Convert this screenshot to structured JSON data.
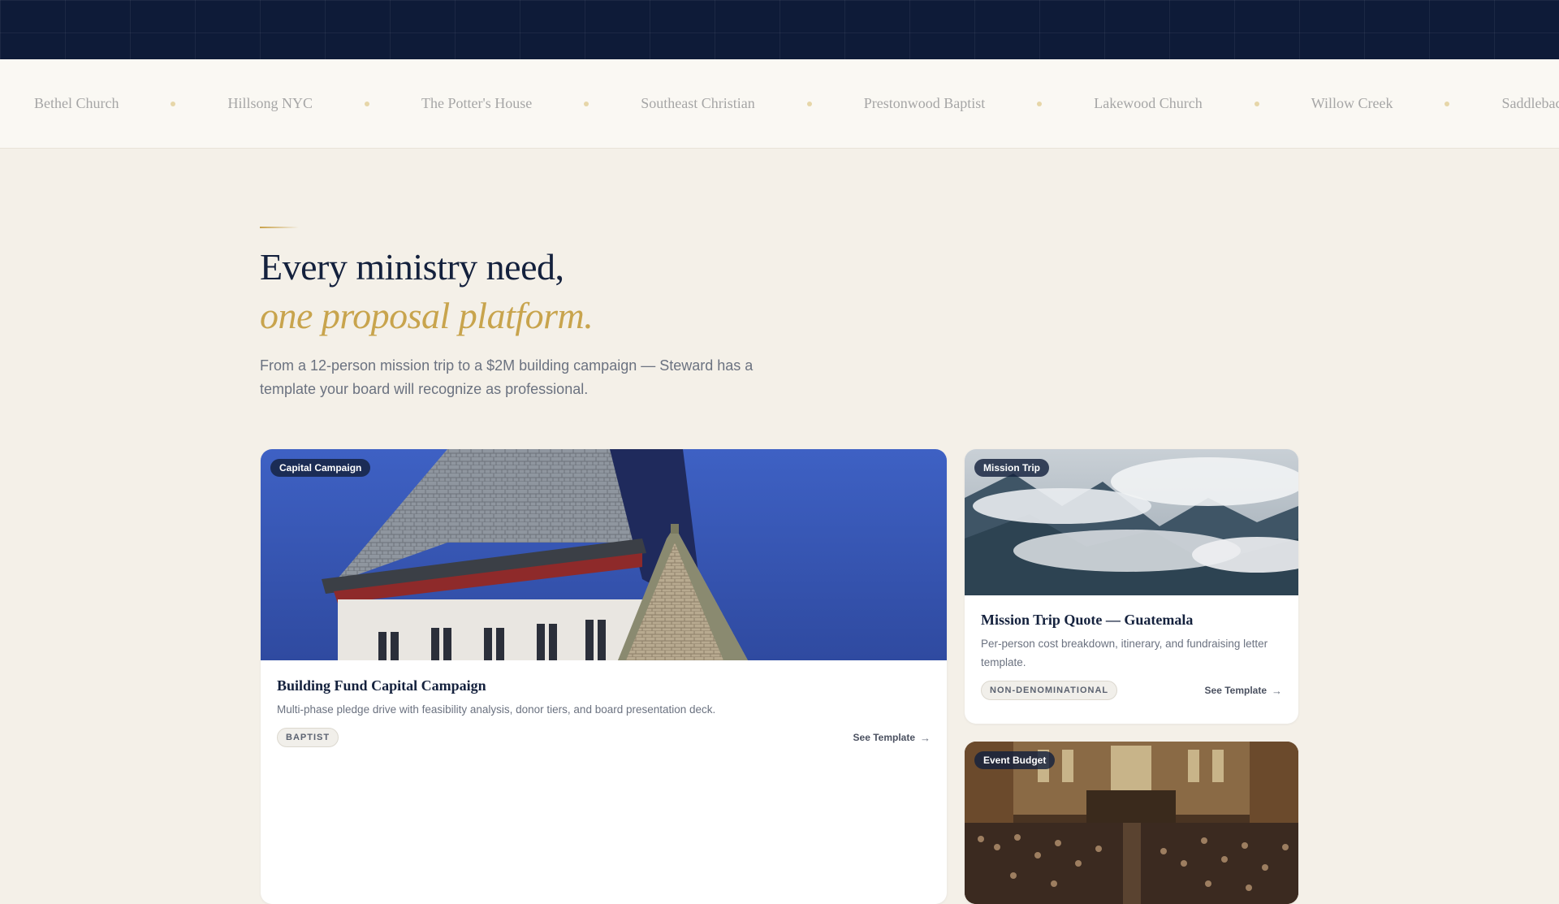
{
  "ticker": {
    "churches": [
      "Bethel Church",
      "Hillsong NYC",
      "The Potter's House",
      "Southeast Christian",
      "Prestonwood Baptist",
      "Lakewood Church",
      "Willow Creek",
      "Saddleback Church"
    ]
  },
  "hero": {
    "title_line1": "Every ministry need,",
    "title_line2": "one proposal platform.",
    "lead": "From a 12-person mission trip to a $2M building campaign — Steward has a template your board will recognize as professional."
  },
  "cards": [
    {
      "badge": "Capital Campaign",
      "title": "Building Fund Capital Campaign",
      "description": "Multi-phase pledge drive with feasibility analysis, donor tiers, and board presentation deck.",
      "tag": "BAPTIST",
      "link": "See Template"
    },
    {
      "badge": "Mission Trip",
      "title": "Mission Trip Quote — Guatemala",
      "description": "Per-person cost breakdown, itinerary, and fundraising letter template.",
      "tag": "NON-DENOMINATIONAL",
      "link": "See Template"
    },
    {
      "badge": "Event Budget"
    }
  ],
  "colors": {
    "navy": "#14213d",
    "gold": "#c8a44d",
    "background": "#f4f0e8"
  }
}
